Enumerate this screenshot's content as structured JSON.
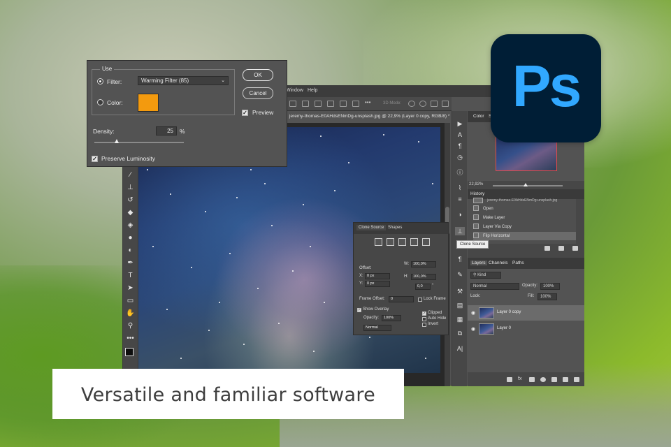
{
  "menubar": {
    "items": [
      "Window",
      "Help"
    ]
  },
  "optionsbar": {
    "mode_label": "3D Mode:"
  },
  "document_tab": {
    "title": "jeremy-thomas-E0AHdsENmDg-unsplash.jpg @ 22,9% (Layer 0 copy, RGB/8) *",
    "close": "×"
  },
  "photo_filter": {
    "group_legend": "Use",
    "filter_label": "Filter:",
    "filter_value": "Warming Filter (85)",
    "color_label": "Color:",
    "color_swatch": "#f39a0e",
    "ok_label": "OK",
    "cancel_label": "Cancel",
    "preview_label": "Preview",
    "preview_checked": true,
    "density_label": "Density:",
    "density_value": "25",
    "density_unit": "%",
    "density_fraction": 0.25,
    "preserve_label": "Preserve Luminosity",
    "preserve_checked": true
  },
  "navigator": {
    "tabs": [
      "Color",
      "Sw"
    ],
    "zoom": "22,92%"
  },
  "history": {
    "title": "History",
    "snapshot": "jeremy-thomas-E0AHdsENmDg-unsplash.jpg",
    "items": [
      "Open",
      "Make Layer",
      "Layer Via Copy",
      "Flip Horizontal"
    ]
  },
  "tooltip": {
    "text": "Clone Source"
  },
  "clone_source": {
    "tabs": [
      "Clone Source",
      "Shapes"
    ],
    "offset_label": "Offset:",
    "x_label": "X:",
    "x_value": "0 px",
    "y_label": "Y:",
    "y_value": "0 px",
    "w_label": "W:",
    "w_value": "100,0%",
    "h_label": "H:",
    "h_value": "100,0%",
    "angle_value": "0,0",
    "angle_unit": "°",
    "frame_offset_label": "Frame Offset:",
    "frame_offset_value": "0",
    "lock_frame_label": "Lock Frame",
    "show_overlay_label": "Show Overlay",
    "opacity_label": "Opacity:",
    "opacity_value": "100%",
    "blend_value": "Normal",
    "clipped_label": "Clipped",
    "auto_hide_label": "Auto Hide",
    "invert_label": "Invert"
  },
  "layers": {
    "tabs": [
      "Layers",
      "Channels",
      "Paths"
    ],
    "kind_label": "Kind",
    "blend_mode": "Normal",
    "opacity_label": "Opacity:",
    "opacity_value": "100%",
    "lock_label": "Lock:",
    "fill_label": "Fill:",
    "fill_value": "100%",
    "rows": [
      {
        "name": "Layer 0 copy",
        "selected": true
      },
      {
        "name": "Layer 0",
        "selected": false
      }
    ]
  },
  "logo": {
    "text": "Ps",
    "bg": "#001e36",
    "fg": "#31a8ff"
  },
  "caption": {
    "text": "Versatile and familiar software"
  }
}
